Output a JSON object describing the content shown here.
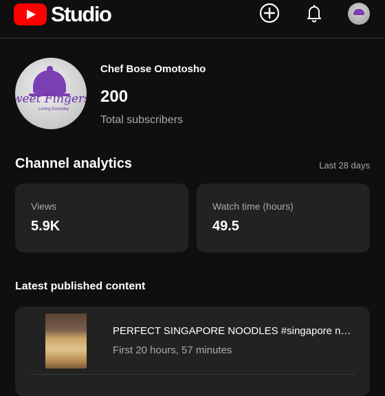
{
  "app": {
    "title": "Studio"
  },
  "icons": {
    "create": "add-circle-icon",
    "notifications": "bell-icon",
    "account": "avatar"
  },
  "colors": {
    "brand": "#ff0000",
    "background": "#0f0f0f",
    "card": "#222222",
    "secondary_text": "#aaaaaa"
  },
  "channel": {
    "name": "Chef Bose Omotosho",
    "subscribers": "200",
    "subscribers_label": "Total subscribers",
    "avatar_brand": "weet Fingers",
    "avatar_tagline": "Loving Everyday"
  },
  "analytics": {
    "title": "Channel analytics",
    "period": "Last 28 days",
    "cards": [
      {
        "label": "Views",
        "value": "5.9K"
      },
      {
        "label": "Watch time (hours)",
        "value": "49.5"
      }
    ]
  },
  "latest": {
    "title": "Latest published content",
    "video": {
      "title": "PERFECT SINGAPORE NOODLES  #singapore noodles",
      "subtitle": "First 20 hours, 57 minutes"
    }
  }
}
